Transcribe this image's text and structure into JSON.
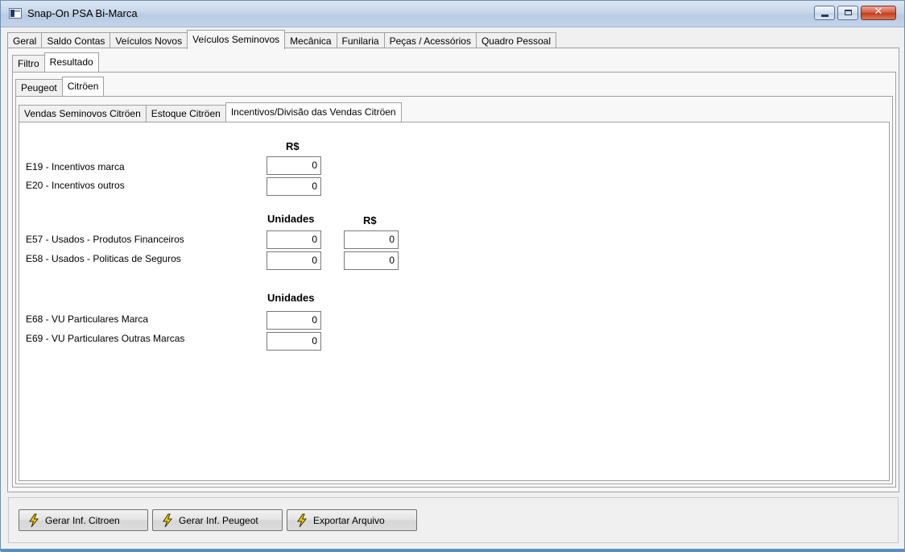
{
  "window": {
    "title": "Snap-On PSA Bi-Marca"
  },
  "main_tabs": [
    "Geral",
    "Saldo Contas",
    "Veículos Novos",
    "Veículos Seminovos",
    "Mecânica",
    "Funilaria",
    "Peças / Acessórios",
    "Quadro Pessoal"
  ],
  "main_tab_active": "Veículos Seminovos",
  "sub_tabs": [
    "Filtro",
    "Resultado"
  ],
  "brand_tabs": [
    "Peugeot",
    "Citröen"
  ],
  "report_tabs": [
    "Vendas Seminovos Citröen",
    "Estoque Citröen",
    "Incentivos/Divisão das Vendas Citröen"
  ],
  "section1": {
    "header": "R$",
    "rows": [
      {
        "label": "E19 - Incentivos marca",
        "value": "0"
      },
      {
        "label": "E20 - Incentivos outros",
        "value": "0"
      }
    ]
  },
  "section2": {
    "header_units": "Unidades",
    "header_money": "R$",
    "rows": [
      {
        "label": "E57 - Usados - Produtos Financeiros",
        "units": "0",
        "money": "0"
      },
      {
        "label": "E58 - Usados - Politicas de Seguros",
        "units": "0",
        "money": "0"
      }
    ]
  },
  "section3": {
    "header": "Unidades",
    "rows": [
      {
        "label": "E68 - VU Particulares Marca",
        "value": "0"
      },
      {
        "label": "E69 - VU Particulares Outras Marcas",
        "value": "0"
      }
    ]
  },
  "buttons": {
    "gerar_citroen": "Gerar Inf. Citroen",
    "gerar_peugeot": "Gerar Inf. Peugeot",
    "exportar": "Exportar Arquivo"
  },
  "icons": {
    "app": "app-window-icon",
    "button": "lightning-bolt-icon"
  }
}
